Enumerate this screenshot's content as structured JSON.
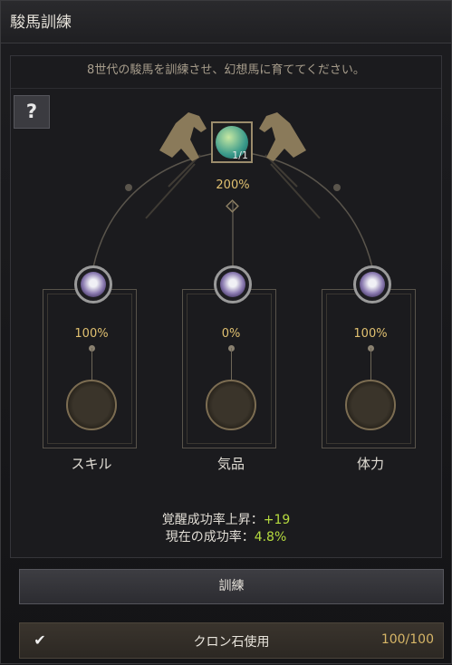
{
  "window": {
    "title": "駿馬訓練"
  },
  "panel": {
    "subtitle": "8世代の駿馬を訓練させ、幻想馬に育ててください。",
    "help_label": "?",
    "emblem": {
      "count": "1/1",
      "icon": "horse-emblem-icon"
    },
    "total_rate": "200%"
  },
  "stats": [
    {
      "label": "スキル",
      "rate": "100%",
      "progress": 1.0,
      "icon": "horse-skill-icon"
    },
    {
      "label": "気品",
      "rate": "0%",
      "progress": 0.0,
      "icon": "horse-grace-icon"
    },
    {
      "label": "体力",
      "rate": "100%",
      "progress": 1.0,
      "icon": "horse-stamina-icon"
    }
  ],
  "result": {
    "awaken_label": "覚醒成功率上昇：",
    "awaken_value": "+19",
    "current_label": "現在の成功率：",
    "current_value": "4.8%"
  },
  "actions": {
    "train_label": "訓練"
  },
  "stone": {
    "checked": true,
    "label": "クロン石使用",
    "count": "100/100"
  },
  "colors": {
    "accent": "#e0c070",
    "green": "#b6db3f"
  }
}
